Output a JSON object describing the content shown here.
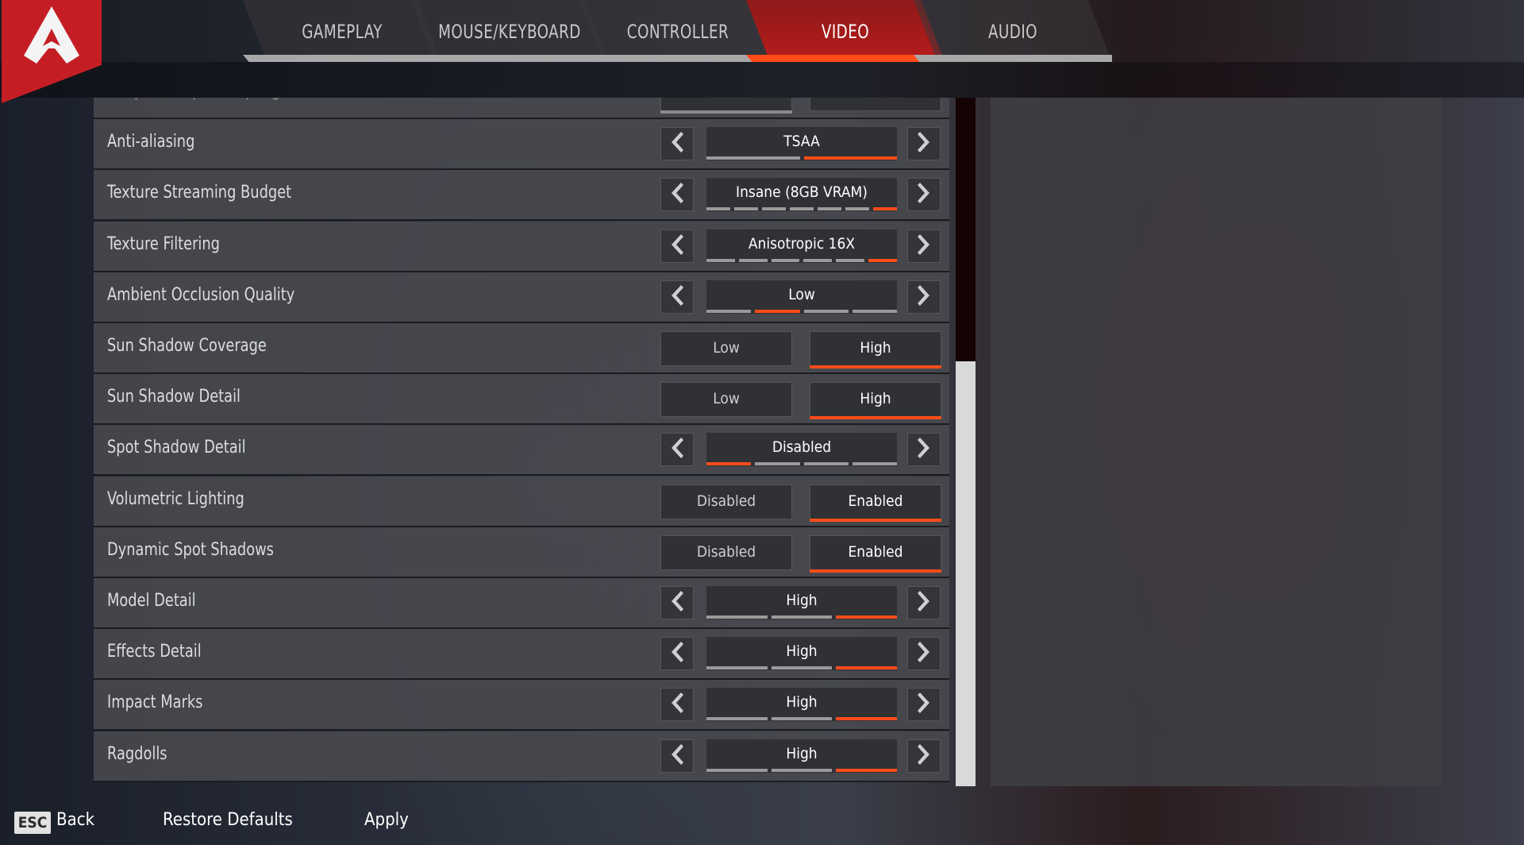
{
  "header": {
    "logo": "apex-legends-logo",
    "tabs": [
      {
        "label": "GAMEPLAY",
        "active": false
      },
      {
        "label": "MOUSE/KEYBOARD",
        "active": false
      },
      {
        "label": "CONTROLLER",
        "active": false
      },
      {
        "label": "VIDEO",
        "active": true
      },
      {
        "label": "AUDIO",
        "active": false
      }
    ]
  },
  "colors": {
    "accent": "#ff4c1a",
    "brand_red": "#c41e24"
  },
  "settings": [
    {
      "label": "Adaptive Supersampling",
      "type": "toggle",
      "options": [
        "Disabled",
        "Enabled"
      ],
      "selected": 0,
      "faded": true
    },
    {
      "label": "Anti-aliasing",
      "type": "cycle",
      "value": "TSAA",
      "segments": 2,
      "index": 1
    },
    {
      "label": "Texture Streaming Budget",
      "type": "cycle",
      "value": "Insane (8GB VRAM)",
      "segments": 7,
      "index": 6
    },
    {
      "label": "Texture Filtering",
      "type": "cycle",
      "value": "Anisotropic 16X",
      "segments": 6,
      "index": 5
    },
    {
      "label": "Ambient Occlusion Quality",
      "type": "cycle",
      "value": "Low",
      "segments": 4,
      "index": 1
    },
    {
      "label": "Sun Shadow Coverage",
      "type": "toggle",
      "options": [
        "Low",
        "High"
      ],
      "selected": 1
    },
    {
      "label": "Sun Shadow Detail",
      "type": "toggle",
      "options": [
        "Low",
        "High"
      ],
      "selected": 1
    },
    {
      "label": "Spot Shadow Detail",
      "type": "cycle",
      "value": "Disabled",
      "segments": 4,
      "index": 0
    },
    {
      "label": "Volumetric Lighting",
      "type": "toggle",
      "options": [
        "Disabled",
        "Enabled"
      ],
      "selected": 1
    },
    {
      "label": "Dynamic Spot Shadows",
      "type": "toggle",
      "options": [
        "Disabled",
        "Enabled"
      ],
      "selected": 1
    },
    {
      "label": "Model Detail",
      "type": "cycle",
      "value": "High",
      "segments": 3,
      "index": 2
    },
    {
      "label": "Effects Detail",
      "type": "cycle",
      "value": "High",
      "segments": 3,
      "index": 2
    },
    {
      "label": "Impact Marks",
      "type": "cycle",
      "value": "High",
      "segments": 3,
      "index": 2
    },
    {
      "label": "Ragdolls",
      "type": "cycle",
      "value": "High",
      "segments": 3,
      "index": 2
    }
  ],
  "scrollbar": {
    "position_fraction": 0.38,
    "visible_fraction": 0.62
  },
  "footer": {
    "esc_key": "ESC",
    "back_label": "Back",
    "restore_label": "Restore Defaults",
    "apply_label": "Apply"
  }
}
